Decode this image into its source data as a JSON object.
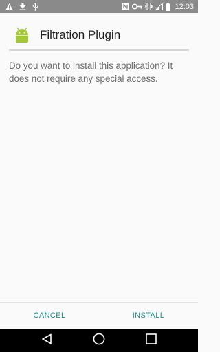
{
  "status_bar": {
    "time": "12:03",
    "icons": [
      "warning-icon",
      "download-icon",
      "usb-icon",
      "nfc-icon",
      "vpn-key-icon",
      "vibrate-icon",
      "signal-icon",
      "battery-icon"
    ]
  },
  "app": {
    "name": "Filtration Plugin",
    "icon": "android-icon",
    "icon_color": "#a4c639"
  },
  "message": "Do you want to install this application? It does not require any special access.",
  "actions": {
    "cancel_label": "CANCEL",
    "install_label": "INSTALL",
    "accent_color": "#1a8a8a"
  },
  "nav_bar": {
    "icons": [
      "back-icon",
      "home-icon",
      "recents-icon"
    ]
  }
}
